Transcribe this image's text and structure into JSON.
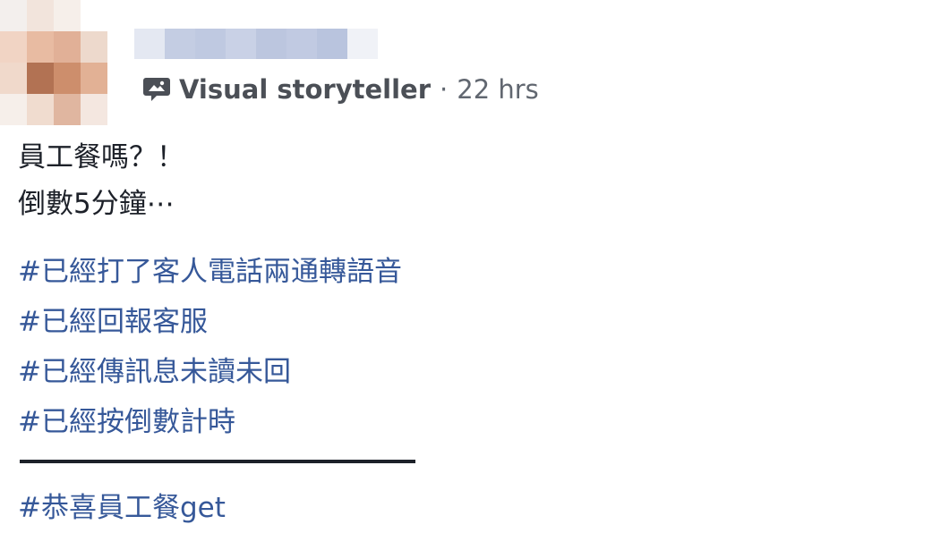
{
  "header": {
    "role_label": "Visual storyteller",
    "separator": "·",
    "timestamp": "22 hrs",
    "role_icon": "visual-storyteller-badge-icon"
  },
  "post": {
    "lines": [
      "員工餐嗎？！",
      "倒數5分鐘⋯"
    ],
    "hashtags": [
      "#已經打了客人電話兩通轉語音",
      "#已經回報客服",
      "#已經傳訊息未讀未回",
      "#已經按倒數計時"
    ],
    "final_hashtag": "#恭喜員工餐get"
  },
  "colors": {
    "text": "#1d2129",
    "meta": "#616770",
    "link": "#365899"
  }
}
